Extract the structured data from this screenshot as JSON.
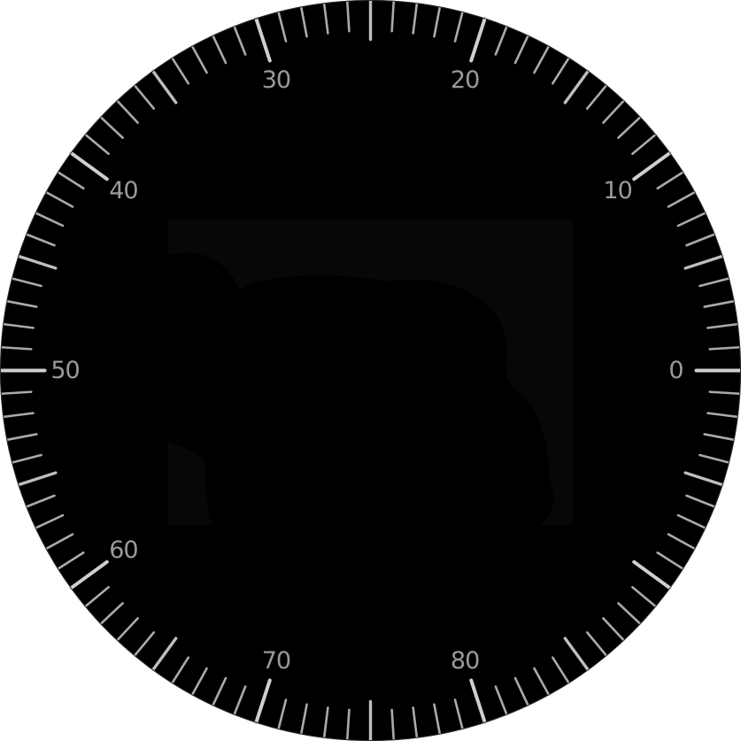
{
  "dial": {
    "face_color": "#000000",
    "tick_color": "#cfcfcf",
    "label_color": "#9a9a9a",
    "scale_labels": [
      "0",
      "10",
      "20",
      "30",
      "40",
      "50",
      "60",
      "70",
      "80"
    ],
    "background_icon": "silhouette-icon"
  }
}
